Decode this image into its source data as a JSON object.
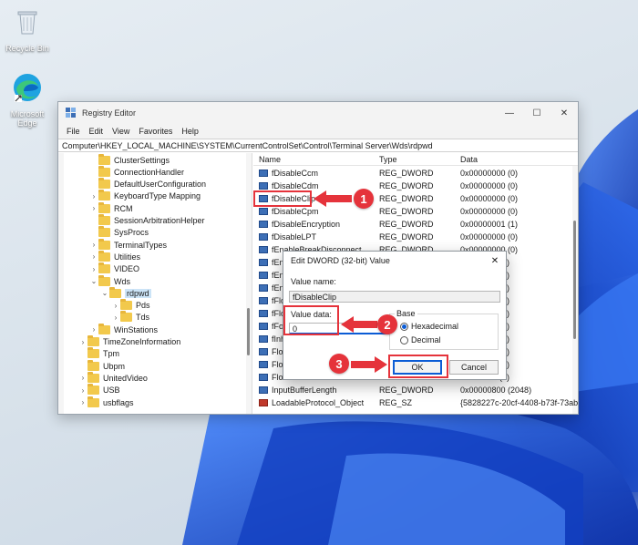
{
  "desktop": {
    "recycle_bin_label": "Recycle Bin",
    "edge_label_1": "Microsoft",
    "edge_label_2": "Edge"
  },
  "window": {
    "title": "Registry Editor",
    "minimize": "—",
    "maximize": "☐",
    "close": "✕",
    "menu": [
      "File",
      "Edit",
      "View",
      "Favorites",
      "Help"
    ],
    "address": "Computer\\HKEY_LOCAL_MACHINE\\SYSTEM\\CurrentControlSet\\Control\\Terminal Server\\Wds\\rdpwd"
  },
  "tree": [
    {
      "label": "ClusterSettings",
      "chevron": ""
    },
    {
      "label": "ConnectionHandler",
      "chevron": ""
    },
    {
      "label": "DefaultUserConfiguration",
      "chevron": ""
    },
    {
      "label": "KeyboardType Mapping",
      "chevron": "›"
    },
    {
      "label": "RCM",
      "chevron": "›"
    },
    {
      "label": "SessionArbitrationHelper",
      "chevron": ""
    },
    {
      "label": "SysProcs",
      "chevron": ""
    },
    {
      "label": "TerminalTypes",
      "chevron": "›"
    },
    {
      "label": "Utilities",
      "chevron": "›"
    },
    {
      "label": "VIDEO",
      "chevron": "›"
    },
    {
      "label": "Wds",
      "chevron": "⌄"
    },
    {
      "label": "rdpwd",
      "chevron": "⌄"
    },
    {
      "label": "Pds",
      "chevron": "›"
    },
    {
      "label": "Tds",
      "chevron": "›"
    },
    {
      "label": "WinStations",
      "chevron": "›"
    },
    {
      "label": "TimeZoneInformation",
      "chevron": "›"
    },
    {
      "label": "Tpm",
      "chevron": ""
    },
    {
      "label": "Ubpm",
      "chevron": ""
    },
    {
      "label": "UnitedVideo",
      "chevron": "›"
    },
    {
      "label": "USB",
      "chevron": "›"
    },
    {
      "label": "usbflags",
      "chevron": "›"
    }
  ],
  "list": {
    "headers": {
      "name": "Name",
      "type": "Type",
      "data": "Data"
    },
    "rows": [
      {
        "name": "fDisableCcm",
        "type": "REG_DWORD",
        "data": "0x00000000 (0)"
      },
      {
        "name": "fDisableCdm",
        "type": "REG_DWORD",
        "data": "0x00000000 (0)"
      },
      {
        "name": "fDisableClip",
        "type": "REG_DWORD",
        "data": "0x00000000 (0)"
      },
      {
        "name": "fDisableCpm",
        "type": "REG_DWORD",
        "data": "0x00000000 (0)"
      },
      {
        "name": "fDisableEncryption",
        "type": "REG_DWORD",
        "data": "0x00000001 (1)"
      },
      {
        "name": "fDisableLPT",
        "type": "REG_DWORD",
        "data": "0x00000000 (0)"
      },
      {
        "name": "fEnableBreakDisconnect",
        "type": "REG_DWORD",
        "data": "0x00000000 (0)"
      },
      {
        "name": "fEna",
        "type": "",
        "data": "(1)"
      },
      {
        "name": "fEna",
        "type": "",
        "data": "(1)"
      },
      {
        "name": "fEna",
        "type": "",
        "data": "(1)"
      },
      {
        "name": "fFlo",
        "type": "",
        "data": "(1)"
      },
      {
        "name": "fFlo",
        "type": "",
        "data": "(1)"
      },
      {
        "name": "fFor",
        "type": "",
        "data": "(1)"
      },
      {
        "name": "fInh",
        "type": "",
        "data": "(1)"
      },
      {
        "name": "Flow",
        "type": "",
        "data": "(1)"
      },
      {
        "name": "Flow",
        "type": "",
        "data": "(1)"
      },
      {
        "name": "Flow",
        "type": "",
        "data": "(1)"
      },
      {
        "name": "InputBufferLength",
        "type": "REG_DWORD",
        "data": "0x00000800 (2048)"
      },
      {
        "name": "LoadableProtocol_Object",
        "type": "REG_SZ",
        "data": "{5828227c-20cf-4408-b73f-73ab70b8849f}"
      }
    ]
  },
  "dialog": {
    "title": "Edit DWORD (32-bit) Value",
    "close": "✕",
    "value_name_label": "Value name:",
    "value_name": "fDisableClip",
    "value_data_label": "Value data:",
    "value_data": "0",
    "base_label": "Base",
    "hex_label": "Hexadecimal",
    "dec_label": "Decimal",
    "ok": "OK",
    "cancel": "Cancel"
  },
  "callouts": [
    "1",
    "2",
    "3"
  ],
  "colors": {
    "accent_red": "#e5333b",
    "windows_blue": "#1a4fd6"
  }
}
